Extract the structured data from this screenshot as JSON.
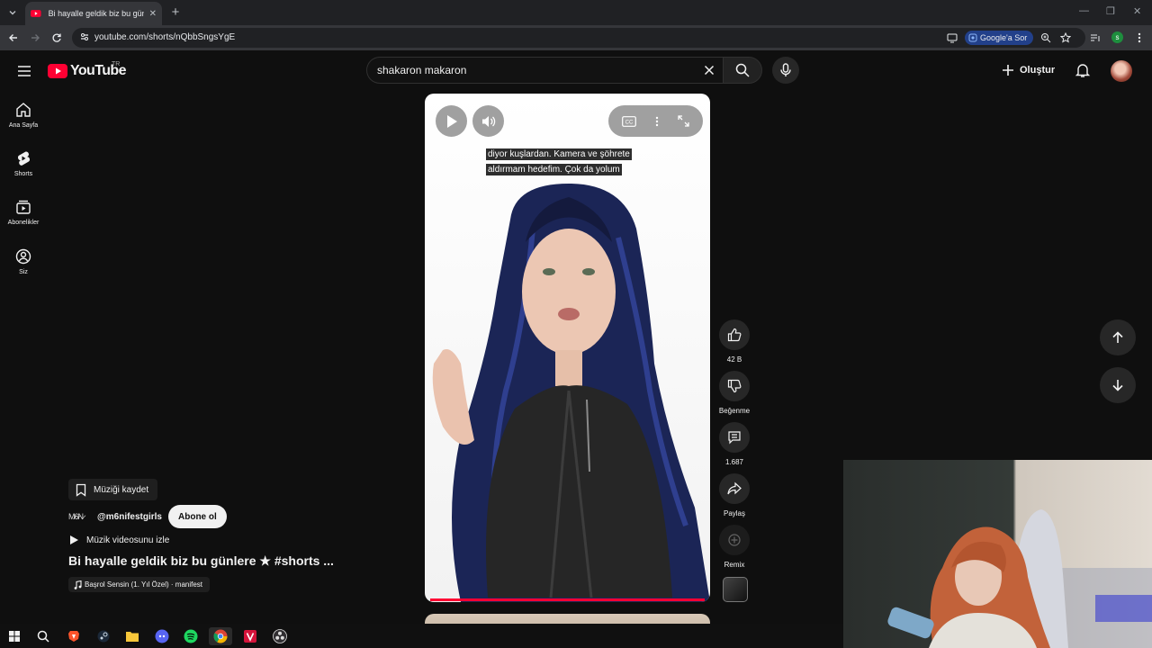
{
  "browser": {
    "tab_title": "Bi hayalle geldik biz bu günlere",
    "url": "youtube.com/shorts/nQbbSngsYgE",
    "google_ask_label": "Google'a Sor",
    "profile_initial": "s"
  },
  "header": {
    "logo_text": "YouTube",
    "region": "TR",
    "search_query": "shakaron makaron",
    "create_label": "Oluştur"
  },
  "sidebar": {
    "items": [
      {
        "label": "Ana Sayfa",
        "icon": "home-icon"
      },
      {
        "label": "Shorts",
        "icon": "shorts-icon"
      },
      {
        "label": "Abonelikler",
        "icon": "subscriptions-icon"
      },
      {
        "label": "Siz",
        "icon": "you-icon"
      }
    ]
  },
  "player": {
    "caption_line1": "diyor kuşlardan. Kamera ve şöhrete",
    "caption_line2": "aldırmam hedefim. Çok da yolum",
    "progress": 1.0
  },
  "actions": {
    "like_count": "42 B",
    "dislike_label": "Beğenme",
    "comment_count": "1.687",
    "share_label": "Paylaş",
    "remix_label": "Remix"
  },
  "meta": {
    "save_music_label": "Müziği kaydet",
    "channel_avatar_text": "M̷6̷N̷",
    "channel_handle": "@m6nifestgirls",
    "subscribe_label": "Abone ol",
    "watch_music_label": "Müzik videosunu izle",
    "title": "Bi hayalle geldik biz bu günlere ★  #shorts ...",
    "sound_label": "Başrol Sensin (1. Yıl Özel) · manifest"
  },
  "colors": {
    "background": "#0f0f0f",
    "accent_red": "#ff0033",
    "chip_bg": "#272727"
  }
}
